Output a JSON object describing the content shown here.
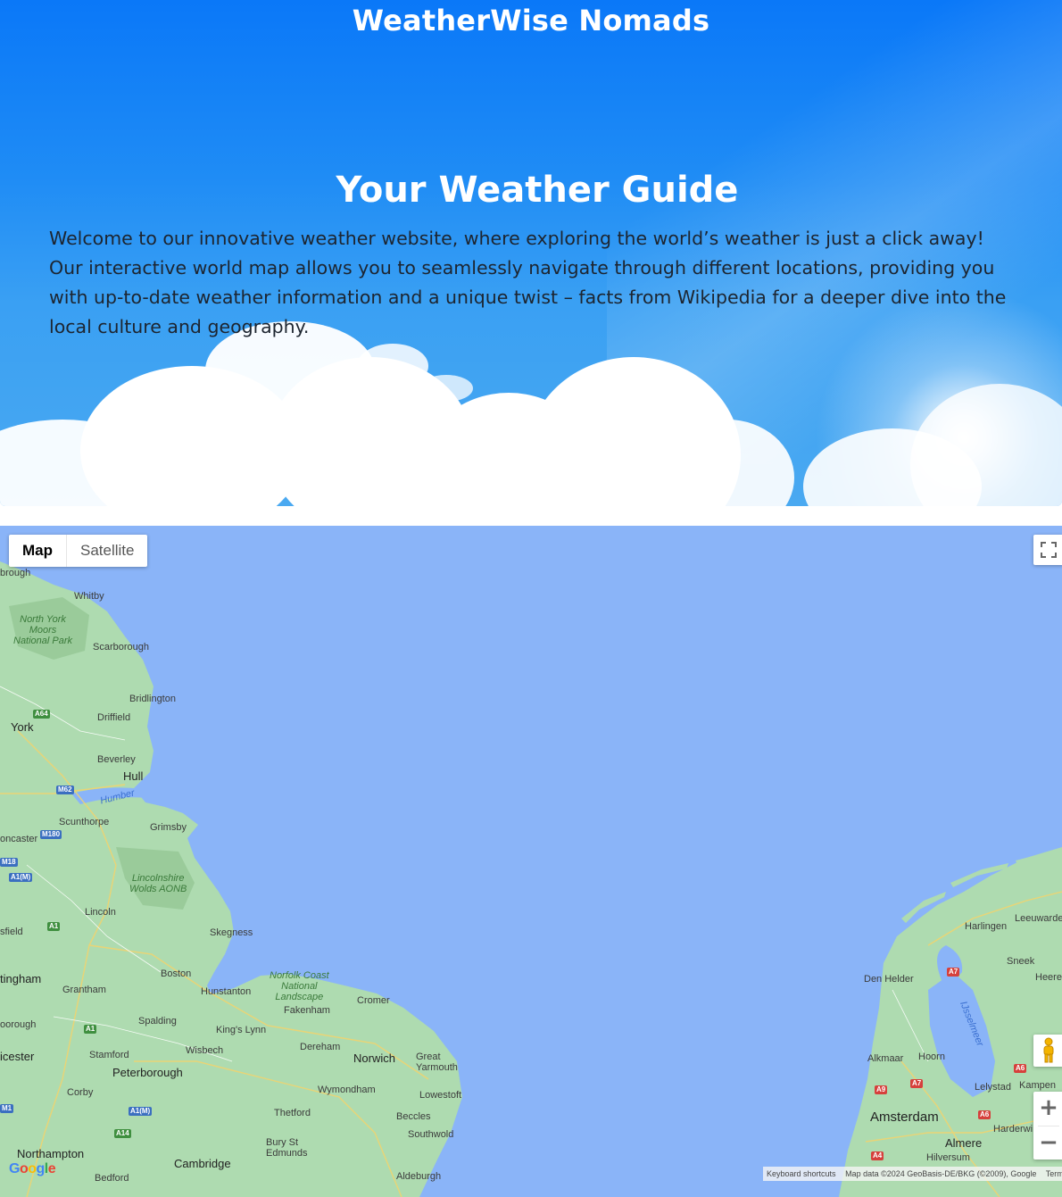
{
  "header": {
    "site_title": "WeatherWise Nomads"
  },
  "hero": {
    "heading": "Your Weather Guide",
    "description": "Welcome to our innovative weather website, where exploring the world’s weather is just a click away! Our interactive world map allows you to seamlessly navigate through different locations, providing you with up-to-date weather information and a unique twist – facts from Wikipedia for a deeper dive into the local culture and geography."
  },
  "map": {
    "type_buttons": {
      "map": "Map",
      "satellite": "Satellite"
    },
    "active_type": "Map",
    "zoom_in": "+",
    "zoom_out": "−",
    "logo": "Google",
    "attribution": {
      "shortcuts": "Keyboard shortcuts",
      "data": "Map data ©2024 GeoBasis-DE/BKG (©2009), Google",
      "terms": "Terms"
    },
    "labels": {
      "brough": "brough",
      "whitby": "Whitby",
      "north_york_moors": "North York\nMoors\nNational Park",
      "scarborough": "Scarborough",
      "bridlington": "Bridlington",
      "driffield": "Driffield",
      "york": "York",
      "beverley": "Beverley",
      "hull": "Hull",
      "humber": "Humber",
      "scunthorpe": "Scunthorpe",
      "grimsby": "Grimsby",
      "doncaster": "oncaster",
      "lincolnshire_wolds": "Lincolnshire\nWolds AONB",
      "lincoln": "Lincoln",
      "mansfield": "sfield",
      "skegness": "Skegness",
      "nottingham": "tingham",
      "boston": "Boston",
      "grantham": "Grantham",
      "hunstanton": "Hunstanton",
      "norfolk_coast": "Norfolk Coast\nNational\nLandscape",
      "cromer": "Cromer",
      "fakenham": "Fakenham",
      "kings_lynn": "King's Lynn",
      "spalding": "Spalding",
      "borough": "oorough",
      "dereham": "Dereham",
      "norwich": "Norwich",
      "great_yarmouth": "Great\nYarmouth",
      "leicester": "icester",
      "stamford": "Stamford",
      "wisbech": "Wisbech",
      "peterborough": "Peterborough",
      "wymondham": "Wymondham",
      "lowestoft": "Lowestoft",
      "corby": "Corby",
      "thetford": "Thetford",
      "beccles": "Beccles",
      "southwold": "Southwold",
      "bury_st_edmunds": "Bury St\nEdmunds",
      "northampton": "Northampton",
      "cambridge": "Cambridge",
      "aldeburgh": "Aldeburgh",
      "bedford": "Bedford",
      "harlingen": "Harlingen",
      "leeuwarden": "Leeuwarde",
      "sneek": "Sneek",
      "heerenveen": "Heere",
      "den_helder": "Den Helder",
      "ijsselmeer": "IJsselmeer",
      "alkmaar": "Alkmaar",
      "hoorn": "Hoorn",
      "lelystad": "Lelystad",
      "kampen": "Kampen",
      "amsterdam": "Amsterdam",
      "harderwijk": "Harderwi",
      "almere": "Almere",
      "hilversum": "Hilversum"
    },
    "roads": [
      "A64",
      "M62",
      "M180",
      "M18",
      "A1(M)",
      "A1",
      "A1",
      "A1(M)",
      "A14",
      "M1",
      "A7",
      "A9",
      "A7",
      "A6",
      "A6",
      "A4"
    ]
  }
}
